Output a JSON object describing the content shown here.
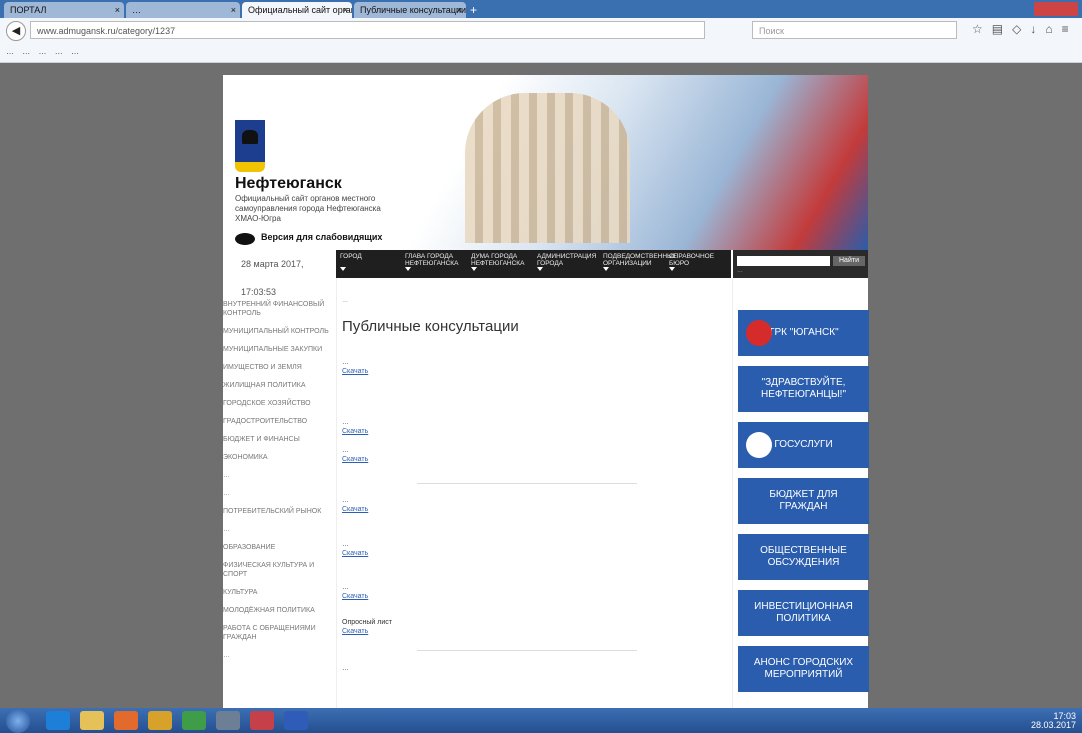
{
  "browser": {
    "tabs": [
      {
        "label": "ПОРТАЛ",
        "active": false
      },
      {
        "label": "…",
        "active": false
      },
      {
        "label": "Официальный сайт органов …",
        "active": true
      },
      {
        "label": "Публичные консультации",
        "active": false
      }
    ],
    "new_tab": "+",
    "url": "www.admugansk.ru/category/1237",
    "search_placeholder": "Поиск",
    "bookmarks": [
      "…",
      "…",
      "…",
      "…",
      "…"
    ]
  },
  "site": {
    "brand": "Нефтеюганск",
    "brand_subtitle": "Официальный сайт органов местного самоуправления города Нефтеюганска ХМАО-Югра",
    "accessibility_label": "Версия для слабовидящих",
    "date": "28 марта 2017, 17:03:53",
    "menu": [
      "ГОРОД",
      "ГЛАВА ГОРОДА НЕФТЕЮГАНСКА",
      "ДУМА ГОРОДА НЕФТЕЮГАНСКА",
      "АДМИНИСТРАЦИЯ ГОРОДА",
      "ПОДВЕДОМСТВЕННЫЕ ОРГАНИЗАЦИИ",
      "СПРАВОЧНОЕ БЮРО"
    ],
    "search_button": "Найти",
    "search_hint": "…"
  },
  "sidebar": [
    "Внутренний финансовый контроль",
    "Муниципальный контроль",
    "Муниципальные закупки",
    "Имущество и земля",
    "Жилищная политика",
    "Городское хозяйство",
    "Градостроительство",
    "Бюджет и финансы",
    "Экономика",
    "…",
    "…",
    "Потребительский рынок",
    "…",
    "Образование",
    "Физическая культура и спорт",
    "Культура",
    "Молодёжная политика",
    "Работа с обращениями граждан",
    "…"
  ],
  "content": {
    "breadcrumbs": "…",
    "title": "Публичные консультации",
    "download_label": "Скачать",
    "documents": [
      {
        "text": "…"
      },
      {
        "text": "…"
      },
      {
        "text": "…"
      },
      {
        "text": "…"
      },
      {
        "text": "…"
      },
      {
        "text": "…"
      },
      {
        "text": "Опросный лист"
      },
      {
        "text": "…"
      }
    ]
  },
  "banners": [
    {
      "label": "ТРК \"ЮГАНСК\"",
      "color": "#2a5dae",
      "logo": "red"
    },
    {
      "label": "\"ЗДРАВСТВУЙТЕ, НЕФТЕЮГАНЦЫ!\"",
      "color": "#2a5dae",
      "logo": "none"
    },
    {
      "label": "ГОСУСЛУГИ",
      "color": "#2a5dae",
      "logo": "white"
    },
    {
      "label": "БЮДЖЕТ ДЛЯ ГРАЖДАН",
      "color": "#2a5dae",
      "logo": "none"
    },
    {
      "label": "ОБЩЕСТВЕННЫЕ ОБСУЖДЕНИЯ",
      "color": "#2a5dae",
      "logo": "none"
    },
    {
      "label": "ИНВЕСТИЦИОННАЯ ПОЛИТИКА",
      "color": "#2a5dae",
      "logo": "none"
    },
    {
      "label": "АНОНС ГОРОДСКИХ МЕРОПРИЯТИЙ",
      "color": "#2a5dae",
      "logo": "none"
    }
  ],
  "taskbar": {
    "time": "17:03",
    "date": "28.03.2017"
  }
}
